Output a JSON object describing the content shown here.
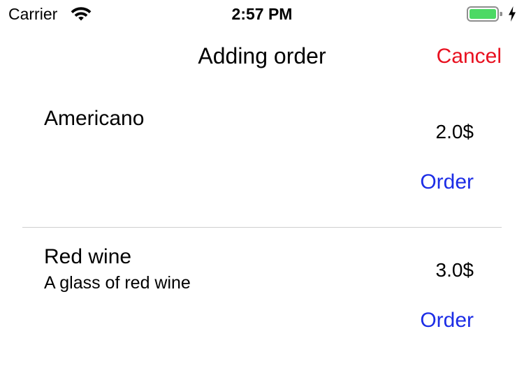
{
  "status_bar": {
    "carrier": "Carrier",
    "time": "2:57 PM",
    "wifi_icon": "wifi-icon",
    "battery_icon": "battery-icon",
    "charging_icon": "charging-bolt-icon",
    "battery_color": "#4cd964"
  },
  "nav": {
    "title": "Adding order",
    "cancel_label": "Cancel",
    "cancel_color": "#e8101f"
  },
  "items": [
    {
      "name": "Americano",
      "description": "",
      "price": "2.0$",
      "order_label": "Order"
    },
    {
      "name": "Red wine",
      "description": "A glass of red wine",
      "price": "3.0$",
      "order_label": "Order"
    }
  ],
  "accent_color": "#1c2de6"
}
